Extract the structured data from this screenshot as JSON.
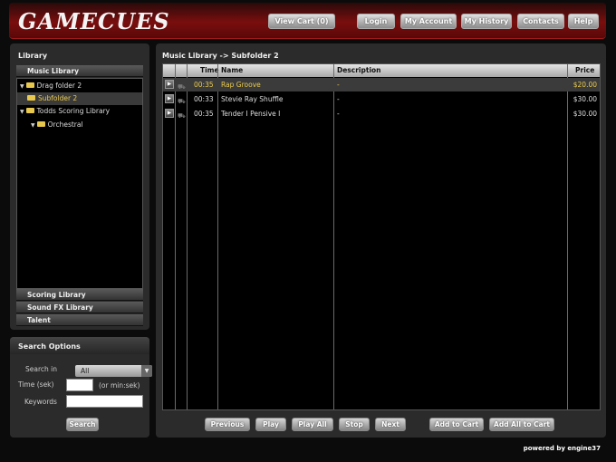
{
  "header": {
    "logo": "GAMECUES",
    "buttons": {
      "view_cart": "View Cart (0)",
      "login": "Login",
      "my_account": "My Account",
      "my_history": "My History",
      "contacts": "Contacts",
      "help": "Help"
    }
  },
  "library": {
    "title": "Library",
    "music_library": "Music Library",
    "tree": [
      {
        "label": "Drag folder 2",
        "selected": false
      },
      {
        "label": "Subfolder 2",
        "selected": true
      },
      {
        "label": "Todds Scoring Library",
        "selected": false
      },
      {
        "label": "Orchestral",
        "selected": false
      }
    ],
    "sections": {
      "scoring": "Scoring Library",
      "sound_fx": "Sound FX Library",
      "talent": "Talent"
    }
  },
  "search": {
    "title": "Search Options",
    "search_in_label": "Search in",
    "search_in_value": "All",
    "time_label": "Time (sek)",
    "time_hint": "(or min:sek)",
    "keywords_label": "Keywords",
    "search_button": "Search"
  },
  "main": {
    "breadcrumb": "Music Library -> Subfolder 2",
    "columns": {
      "time": "Time",
      "name": "Name",
      "description": "Description",
      "price": "Price"
    },
    "rows": [
      {
        "time": "00:35",
        "name": "Rap Groove",
        "description": "-",
        "price": "$20.00"
      },
      {
        "time": "00:33",
        "name": "Stevie Ray Shuffle",
        "description": "-",
        "price": "$30.00"
      },
      {
        "time": "00:35",
        "name": "Tender I Pensive I",
        "description": "-",
        "price": "$30.00"
      }
    ],
    "controls": {
      "previous": "Previous",
      "play": "Play",
      "play_all": "Play All",
      "stop": "Stop",
      "next": "Next",
      "add_to_cart": "Add to Cart",
      "add_all_to_cart": "Add All to Cart"
    }
  },
  "footer": {
    "powered": "powered by engine37"
  },
  "colors": {
    "accent": "#e8c94e",
    "header_red": "#7a0e0e"
  }
}
